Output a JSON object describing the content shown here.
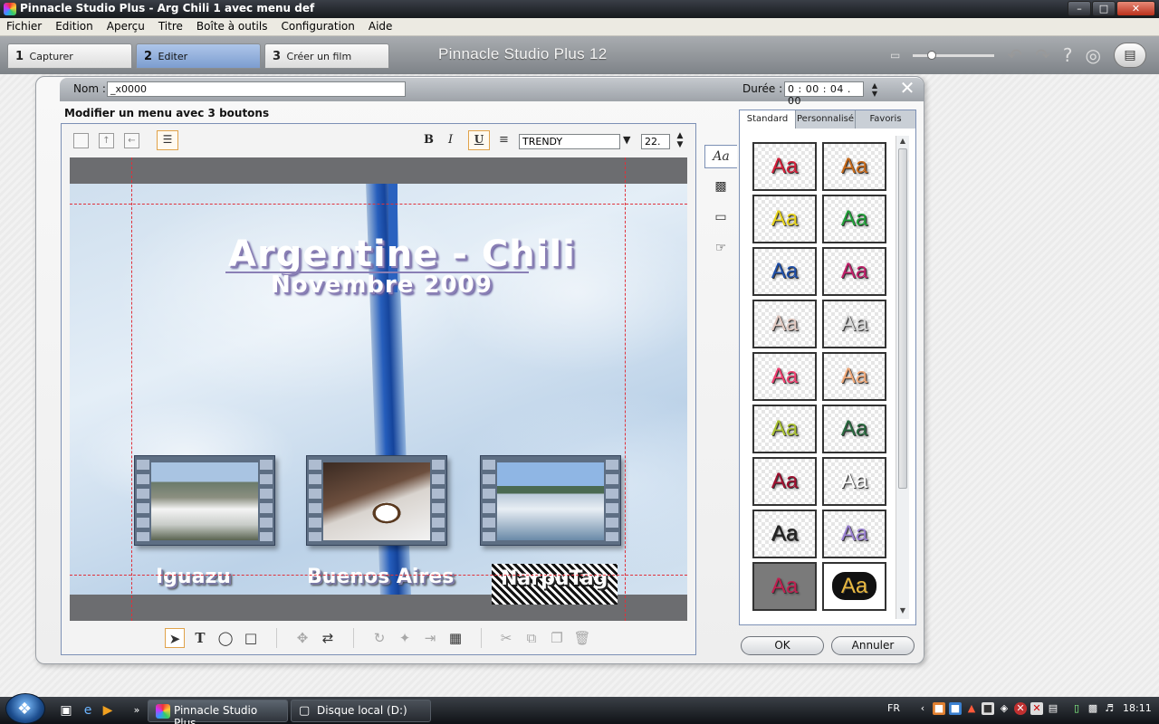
{
  "window": {
    "title": "Pinnacle Studio Plus - Arg Chili 1 avec menu def",
    "controls": [
      "minimize",
      "maximize",
      "close"
    ]
  },
  "menubar": [
    "Fichier",
    "Edition",
    "Aperçu",
    "Titre",
    "Boîte à outils",
    "Configuration",
    "Aide"
  ],
  "stage_tabs": [
    {
      "num": "1",
      "label": "Capturer",
      "active": false
    },
    {
      "num": "2",
      "label": "Editer",
      "active": true
    },
    {
      "num": "3",
      "label": "Créer un film",
      "active": false
    }
  ],
  "brand": "Pinnacle Studio Plus 12",
  "dialog": {
    "name_label": "Nom :",
    "name_value": "_x0000",
    "duration_label": "Durée :",
    "duration_value": "0 : 00 : 04 . 00",
    "heading": "Modifier un menu avec 3 boutons"
  },
  "text_toolbar": {
    "bold": "B",
    "italic": "I",
    "underline": "U",
    "font": "TRENDY",
    "size": "22."
  },
  "canvas": {
    "title_line1": "Argentine - Chili",
    "title_line2": "Novembre 2009",
    "buttons": [
      {
        "caption": "Iguazu",
        "scene": "waterfall"
      },
      {
        "caption": "Buenos Aires",
        "scene": "coffee"
      },
      {
        "caption": "NarpuTag",
        "scene": "boat"
      }
    ],
    "selected_button": "NarpuTag"
  },
  "style_tabs": [
    {
      "label": "Standard",
      "active": true
    },
    {
      "label": "Personnalisé",
      "active": false
    },
    {
      "label": "Favoris",
      "active": false
    }
  ],
  "style_presets": [
    {
      "text": "Aa",
      "color": "#d4203a"
    },
    {
      "text": "Aa",
      "color": "#c86a1a"
    },
    {
      "text": "Aa",
      "color": "#e6d21c"
    },
    {
      "text": "Aa",
      "color": "#22a03a"
    },
    {
      "text": "Aa",
      "color": "#1f4fa8"
    },
    {
      "text": "Aa",
      "color": "#c0206a"
    },
    {
      "text": "Aa",
      "color": "#e0c8c0"
    },
    {
      "text": "Aa",
      "color": "#d8d8d8"
    },
    {
      "text": "Aa",
      "color": "#f04070"
    },
    {
      "text": "Aa",
      "color": "#f0a878"
    },
    {
      "text": "Aa",
      "color": "#a8c030"
    },
    {
      "text": "Aa",
      "color": "#2a6a40"
    },
    {
      "text": "Aa",
      "color": "#a01030"
    },
    {
      "text": "Aa",
      "color": "#ffffff"
    },
    {
      "text": "Aa",
      "color": "#222222"
    },
    {
      "text": "Aa",
      "color": "#9a80d0"
    },
    {
      "text": "Aa",
      "color": "#c02050"
    },
    {
      "text": "Aa",
      "color": "#e8b840"
    }
  ],
  "actions": {
    "ok": "OK",
    "cancel": "Annuler"
  },
  "taskbar": {
    "items": [
      {
        "label": "Pinnacle Studio Plus...",
        "active": true
      },
      {
        "label": "Disque local (D:)",
        "active": false
      }
    ],
    "language": "FR",
    "clock": "18:11"
  }
}
